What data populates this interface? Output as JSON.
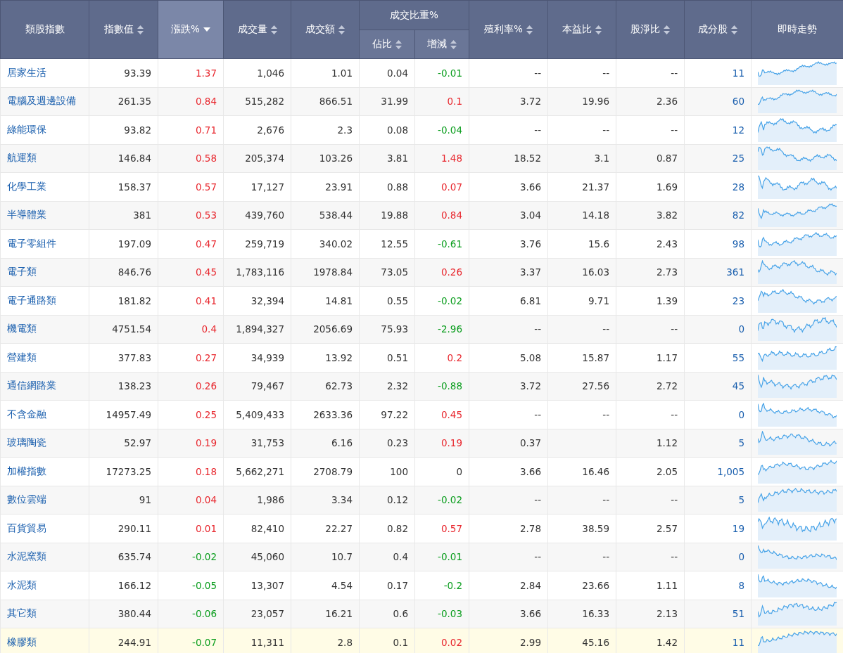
{
  "header": [
    {
      "label": "類股指數",
      "sortable": false,
      "selected": false
    },
    {
      "label": "指數值",
      "sortable": true,
      "selected": false
    },
    {
      "label": "漲跌%",
      "sortable": true,
      "selected": true
    },
    {
      "label": "成交量",
      "sortable": true,
      "selected": false
    },
    {
      "label": "成交額",
      "sortable": true,
      "selected": false
    },
    {
      "label": "成交比重%",
      "children": [
        {
          "label": "佔比",
          "sortable": true,
          "selected": false
        },
        {
          "label": "增減",
          "sortable": true,
          "selected": false
        }
      ]
    },
    {
      "label": "殖利率%",
      "sortable": true,
      "selected": false
    },
    {
      "label": "本益比",
      "sortable": true,
      "selected": false
    },
    {
      "label": "股淨比",
      "sortable": true,
      "selected": false
    },
    {
      "label": "成分股",
      "sortable": true,
      "selected": false
    },
    {
      "label": "即時走勢",
      "sortable": false,
      "selected": false
    }
  ],
  "rows": [
    {
      "name": "居家生活",
      "index": "93.39",
      "change": {
        "text": "1.37",
        "color": "#e8262d"
      },
      "volume": "1,046",
      "amount": "1.01",
      "share": "0.04",
      "delta": {
        "text": "-0.01",
        "color": "#0a9d1d"
      },
      "yield": "--",
      "pe": "--",
      "pb": "--",
      "count": "11",
      "selected": false
    },
    {
      "name": "電腦及週邊設備",
      "index": "261.35",
      "change": {
        "text": "0.84",
        "color": "#e8262d"
      },
      "volume": "515,282",
      "amount": "866.51",
      "share": "31.99",
      "delta": {
        "text": "0.1",
        "color": "#e8262d"
      },
      "yield": "3.72",
      "pe": "19.96",
      "pb": "2.36",
      "count": "60",
      "selected": false
    },
    {
      "name": "綠能環保",
      "index": "93.82",
      "change": {
        "text": "0.71",
        "color": "#e8262d"
      },
      "volume": "2,676",
      "amount": "2.3",
      "share": "0.08",
      "delta": {
        "text": "-0.04",
        "color": "#0a9d1d"
      },
      "yield": "--",
      "pe": "--",
      "pb": "--",
      "count": "12",
      "selected": false
    },
    {
      "name": "航運類",
      "index": "146.84",
      "change": {
        "text": "0.58",
        "color": "#e8262d"
      },
      "volume": "205,374",
      "amount": "103.26",
      "share": "3.81",
      "delta": {
        "text": "1.48",
        "color": "#e8262d"
      },
      "yield": "18.52",
      "pe": "3.1",
      "pb": "0.87",
      "count": "25",
      "selected": false
    },
    {
      "name": "化學工業",
      "index": "158.37",
      "change": {
        "text": "0.57",
        "color": "#e8262d"
      },
      "volume": "17,127",
      "amount": "23.91",
      "share": "0.88",
      "delta": {
        "text": "0.07",
        "color": "#e8262d"
      },
      "yield": "3.66",
      "pe": "21.37",
      "pb": "1.69",
      "count": "28",
      "selected": false
    },
    {
      "name": "半導體業",
      "index": "381",
      "change": {
        "text": "0.53",
        "color": "#e8262d"
      },
      "volume": "439,760",
      "amount": "538.44",
      "share": "19.88",
      "delta": {
        "text": "0.84",
        "color": "#e8262d"
      },
      "yield": "3.04",
      "pe": "14.18",
      "pb": "3.82",
      "count": "82",
      "selected": false
    },
    {
      "name": "電子零組件",
      "index": "197.09",
      "change": {
        "text": "0.47",
        "color": "#e8262d"
      },
      "volume": "259,719",
      "amount": "340.02",
      "share": "12.55",
      "delta": {
        "text": "-0.61",
        "color": "#0a9d1d"
      },
      "yield": "3.76",
      "pe": "15.6",
      "pb": "2.43",
      "count": "98",
      "selected": false
    },
    {
      "name": "電子類",
      "index": "846.76",
      "change": {
        "text": "0.45",
        "color": "#e8262d"
      },
      "volume": "1,783,116",
      "amount": "1978.84",
      "share": "73.05",
      "delta": {
        "text": "0.26",
        "color": "#e8262d"
      },
      "yield": "3.37",
      "pe": "16.03",
      "pb": "2.73",
      "count": "361",
      "selected": false
    },
    {
      "name": "電子通路類",
      "index": "181.82",
      "change": {
        "text": "0.41",
        "color": "#e8262d"
      },
      "volume": "32,394",
      "amount": "14.81",
      "share": "0.55",
      "delta": {
        "text": "-0.02",
        "color": "#0a9d1d"
      },
      "yield": "6.81",
      "pe": "9.71",
      "pb": "1.39",
      "count": "23",
      "selected": false
    },
    {
      "name": "機電類",
      "index": "4751.54",
      "change": {
        "text": "0.4",
        "color": "#e8262d"
      },
      "volume": "1,894,327",
      "amount": "2056.69",
      "share": "75.93",
      "delta": {
        "text": "-2.96",
        "color": "#0a9d1d"
      },
      "yield": "--",
      "pe": "--",
      "pb": "--",
      "count": "0",
      "selected": false
    },
    {
      "name": "營建類",
      "index": "377.83",
      "change": {
        "text": "0.27",
        "color": "#e8262d"
      },
      "volume": "34,939",
      "amount": "13.92",
      "share": "0.51",
      "delta": {
        "text": "0.2",
        "color": "#e8262d"
      },
      "yield": "5.08",
      "pe": "15.87",
      "pb": "1.17",
      "count": "55",
      "selected": false
    },
    {
      "name": "通信網路業",
      "index": "138.23",
      "change": {
        "text": "0.26",
        "color": "#e8262d"
      },
      "volume": "79,467",
      "amount": "62.73",
      "share": "2.32",
      "delta": {
        "text": "-0.88",
        "color": "#0a9d1d"
      },
      "yield": "3.72",
      "pe": "27.56",
      "pb": "2.72",
      "count": "45",
      "selected": false
    },
    {
      "name": "不含金融",
      "index": "14957.49",
      "change": {
        "text": "0.25",
        "color": "#e8262d"
      },
      "volume": "5,409,433",
      "amount": "2633.36",
      "share": "97.22",
      "delta": {
        "text": "0.45",
        "color": "#e8262d"
      },
      "yield": "--",
      "pe": "--",
      "pb": "--",
      "count": "0",
      "selected": false
    },
    {
      "name": "玻璃陶瓷",
      "index": "52.97",
      "change": {
        "text": "0.19",
        "color": "#e8262d"
      },
      "volume": "31,753",
      "amount": "6.16",
      "share": "0.23",
      "delta": {
        "text": "0.19",
        "color": "#e8262d"
      },
      "yield": "0.37",
      "pb": "1.12",
      "count": "5",
      "selected": false
    },
    {
      "name": "加權指數",
      "index": "17273.25",
      "change": {
        "text": "0.18",
        "color": "#e8262d"
      },
      "volume": "5,662,271",
      "amount": "2708.79",
      "share": "100",
      "delta": {
        "text": "0",
        "color": "#333333"
      },
      "yield": "3.66",
      "pe": "16.46",
      "pb": "2.05",
      "count": "1,005",
      "selected": false
    },
    {
      "name": "數位雲端",
      "index": "91",
      "change": {
        "text": "0.04",
        "color": "#e8262d"
      },
      "volume": "1,986",
      "amount": "3.34",
      "share": "0.12",
      "delta": {
        "text": "-0.02",
        "color": "#0a9d1d"
      },
      "yield": "--",
      "pe": "--",
      "pb": "--",
      "count": "5",
      "selected": false
    },
    {
      "name": "百貨貿易",
      "index": "290.11",
      "change": {
        "text": "0.01",
        "color": "#e8262d"
      },
      "volume": "82,410",
      "amount": "22.27",
      "share": "0.82",
      "delta": {
        "text": "0.57",
        "color": "#e8262d"
      },
      "yield": "2.78",
      "pe": "38.59",
      "pb": "2.57",
      "count": "19",
      "selected": false
    },
    {
      "name": "水泥窯類",
      "index": "635.74",
      "change": {
        "text": "-0.02",
        "color": "#0a9d1d"
      },
      "volume": "45,060",
      "amount": "10.7",
      "share": "0.4",
      "delta": {
        "text": "-0.01",
        "color": "#0a9d1d"
      },
      "yield": "--",
      "pe": "--",
      "pb": "--",
      "count": "0",
      "selected": false
    },
    {
      "name": "水泥類",
      "index": "166.12",
      "change": {
        "text": "-0.05",
        "color": "#0a9d1d"
      },
      "volume": "13,307",
      "amount": "4.54",
      "share": "0.17",
      "delta": {
        "text": "-0.2",
        "color": "#0a9d1d"
      },
      "yield": "2.84",
      "pe": "23.66",
      "pb": "1.11",
      "count": "8",
      "selected": false
    },
    {
      "name": "其它類",
      "index": "380.44",
      "change": {
        "text": "-0.06",
        "color": "#0a9d1d"
      },
      "volume": "23,057",
      "amount": "16.21",
      "share": "0.6",
      "delta": {
        "text": "-0.03",
        "color": "#0a9d1d"
      },
      "yield": "3.66",
      "pe": "16.33",
      "pb": "2.13",
      "count": "51",
      "selected": false
    },
    {
      "name": "橡膠類",
      "index": "244.91",
      "change": {
        "text": "-0.07",
        "color": "#0a9d1d"
      },
      "volume": "11,311",
      "amount": "2.8",
      "share": "0.1",
      "delta": {
        "text": "0.02",
        "color": "#e8262d"
      },
      "yield": "2.99",
      "pe": "45.16",
      "pb": "1.42",
      "count": "11",
      "selected": true
    }
  ]
}
